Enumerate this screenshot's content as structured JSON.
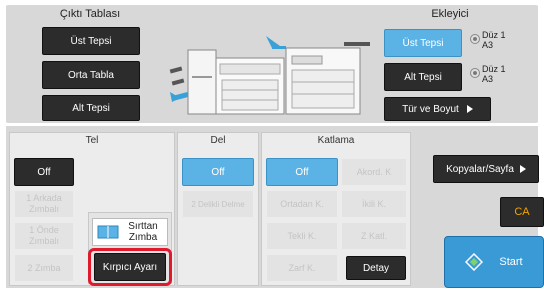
{
  "output_tray": {
    "title": "Çıktı Tablası",
    "upper": "Üst Tepsi",
    "middle": "Orta Tabla",
    "lower": "Alt Tepsi"
  },
  "finisher": {
    "title": "Ekleyici",
    "upper": "Üst Tepsi",
    "lower": "Alt Tepsi",
    "upper_status_line1": "Düz 1",
    "upper_status_line2": "A3",
    "lower_status_line1": "Düz 1",
    "lower_status_line2": "A3",
    "type_size": "Tür ve Boyut"
  },
  "staple": {
    "title": "Tel",
    "off": "Off",
    "one_back": "1 Arkada Zımbalı",
    "one_front": "1 Önde Zımbalı",
    "two": "2 Zımba",
    "saddle": "Sırttan Zımba",
    "kirpici": "Kırpıcı Ayarı"
  },
  "punch": {
    "title": "Del",
    "off": "Off",
    "two_hole": "2 Delikli Delme"
  },
  "fold": {
    "title": "Katlama",
    "off": "Off",
    "accordion": "Akord. K",
    "center": "Ortadan K.",
    "double": "İkili K.",
    "tri": "Tekli K.",
    "z": "Z Katl.",
    "envelope": "Zarf K.",
    "detail": "Detay"
  },
  "right": {
    "copies_per_page": "Kopyalar/Sayfa",
    "ca": "CA",
    "start": "Start"
  },
  "colors": {
    "accent_blue": "#5bb2e5",
    "dark_button": "#2c2c2c",
    "highlight_red": "#e0192e",
    "ca_orange": "#f0a500"
  },
  "icons": [
    "arrow-right-icon",
    "saddle-staple-icon",
    "start-diamond-icon",
    "printer-icon",
    "finisher-arrow-icon"
  ]
}
